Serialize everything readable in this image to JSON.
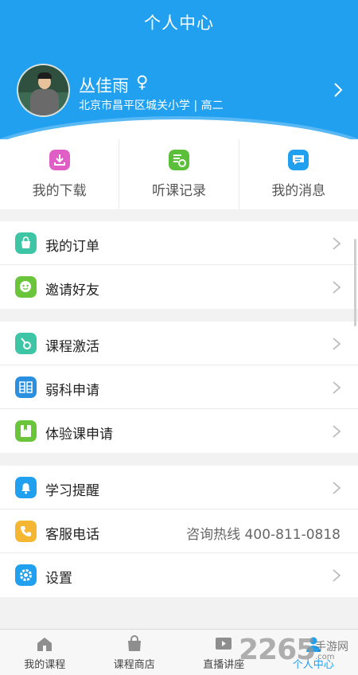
{
  "header": {
    "title": "个人中心",
    "bg_color": "#21a0f0"
  },
  "profile": {
    "name": "丛佳雨",
    "gender_symbol": "♀",
    "school_grade": "北京市昌平区城关小学 | 高二"
  },
  "quick_actions": [
    {
      "label": "我的下载",
      "icon": "download-icon",
      "color": "#e05fc6"
    },
    {
      "label": "听课记录",
      "icon": "history-icon",
      "color": "#5bbf3a"
    },
    {
      "label": "我的消息",
      "icon": "message-icon",
      "color": "#21a0f0"
    }
  ],
  "menu_groups": [
    [
      {
        "label": "我的订单",
        "icon": "bag-icon",
        "color": "#3ec5a6"
      },
      {
        "label": "邀请好友",
        "icon": "friend-icon",
        "color": "#6ac53a"
      }
    ],
    [
      {
        "label": "课程激活",
        "icon": "key-icon",
        "color": "#3ec5a6"
      },
      {
        "label": "弱科申请",
        "icon": "subject-icon",
        "color": "#2b8fe0"
      },
      {
        "label": "体验课申请",
        "icon": "trial-icon",
        "color": "#6ac53a"
      }
    ],
    [
      {
        "label": "学习提醒",
        "icon": "bell-icon",
        "color": "#21a0f0"
      },
      {
        "label": "客服电话",
        "icon": "phone-icon",
        "color": "#f5b731",
        "value": "咨询热线 400-811-0818"
      },
      {
        "label": "设置",
        "icon": "gear-icon",
        "color": "#21a0f0"
      }
    ]
  ],
  "tabbar": [
    {
      "label": "我的课程",
      "icon": "home-icon"
    },
    {
      "label": "课程商店",
      "icon": "shop-icon"
    },
    {
      "label": "直播讲座",
      "icon": "live-icon"
    },
    {
      "label": "个人中心",
      "icon": "person-icon",
      "active": true
    }
  ],
  "watermark": {
    "number": "2265",
    "text": "手游网",
    "url": ".com"
  }
}
